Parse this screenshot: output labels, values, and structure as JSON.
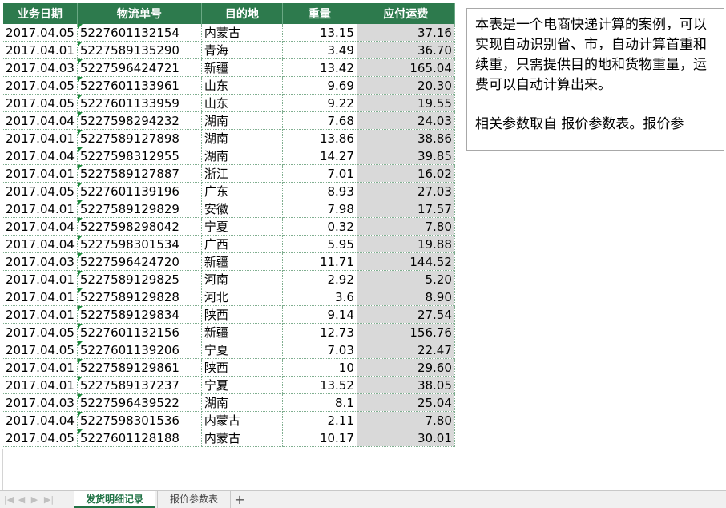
{
  "table": {
    "headers": [
      "业务日期",
      "物流单号",
      "目的地",
      "重量",
      "应付运费"
    ],
    "rows": [
      [
        "2017.04.05",
        "5227601132154",
        "内蒙古",
        "13.15",
        "37.16"
      ],
      [
        "2017.04.01",
        "5227589135290",
        "青海",
        "3.49",
        "36.70"
      ],
      [
        "2017.04.03",
        "5227596424721",
        "新疆",
        "13.42",
        "165.04"
      ],
      [
        "2017.04.05",
        "5227601133961",
        "山东",
        "9.69",
        "20.30"
      ],
      [
        "2017.04.05",
        "5227601133959",
        "山东",
        "9.22",
        "19.55"
      ],
      [
        "2017.04.04",
        "5227598294232",
        "湖南",
        "7.68",
        "24.03"
      ],
      [
        "2017.04.01",
        "5227589127898",
        "湖南",
        "13.86",
        "38.86"
      ],
      [
        "2017.04.04",
        "5227598312955",
        "湖南",
        "14.27",
        "39.85"
      ],
      [
        "2017.04.01",
        "5227589127887",
        "浙江",
        "7.01",
        "16.02"
      ],
      [
        "2017.04.05",
        "5227601139196",
        "广东",
        "8.93",
        "27.03"
      ],
      [
        "2017.04.01",
        "5227589129829",
        "安徽",
        "7.98",
        "17.57"
      ],
      [
        "2017.04.04",
        "5227598298042",
        "宁夏",
        "0.32",
        "7.80"
      ],
      [
        "2017.04.04",
        "5227598301534",
        "广西",
        "5.95",
        "19.88"
      ],
      [
        "2017.04.03",
        "5227596424720",
        "新疆",
        "11.71",
        "144.52"
      ],
      [
        "2017.04.01",
        "5227589129825",
        "河南",
        "2.92",
        "5.20"
      ],
      [
        "2017.04.01",
        "5227589129828",
        "河北",
        "3.6",
        "8.90"
      ],
      [
        "2017.04.01",
        "5227589129834",
        "陕西",
        "9.14",
        "27.54"
      ],
      [
        "2017.04.05",
        "5227601132156",
        "新疆",
        "12.73",
        "156.76"
      ],
      [
        "2017.04.05",
        "5227601139206",
        "宁夏",
        "7.03",
        "22.47"
      ],
      [
        "2017.04.01",
        "5227589129861",
        "陕西",
        "10",
        "29.60"
      ],
      [
        "2017.04.01",
        "5227589137237",
        "宁夏",
        "13.52",
        "38.05"
      ],
      [
        "2017.04.03",
        "5227596439522",
        "湖南",
        "8.1",
        "25.04"
      ],
      [
        "2017.04.04",
        "5227598301536",
        "内蒙古",
        "2.11",
        "7.80"
      ],
      [
        "2017.04.05",
        "5227601128188",
        "内蒙古",
        "10.17",
        "30.01"
      ]
    ]
  },
  "note": {
    "paragraph1": "本表是一个电商快递计算的案例，可以实现自动识别省、市，自动计算首重和续重，只需提供目的地和货物重量，运费可以自动计算出来。",
    "paragraph2": "相关参数取自 报价参数表。报价参"
  },
  "tabs": {
    "active": "发货明细记录",
    "inactive": "报价参数表",
    "add": "+"
  },
  "nav": {
    "first": "|◀",
    "prev": "◀",
    "next": "▶",
    "last": "▶|"
  },
  "colors": {
    "header_bg": "#2d7a4d",
    "fee_bg": "#d9d9d9",
    "active_tab": "#217346"
  }
}
